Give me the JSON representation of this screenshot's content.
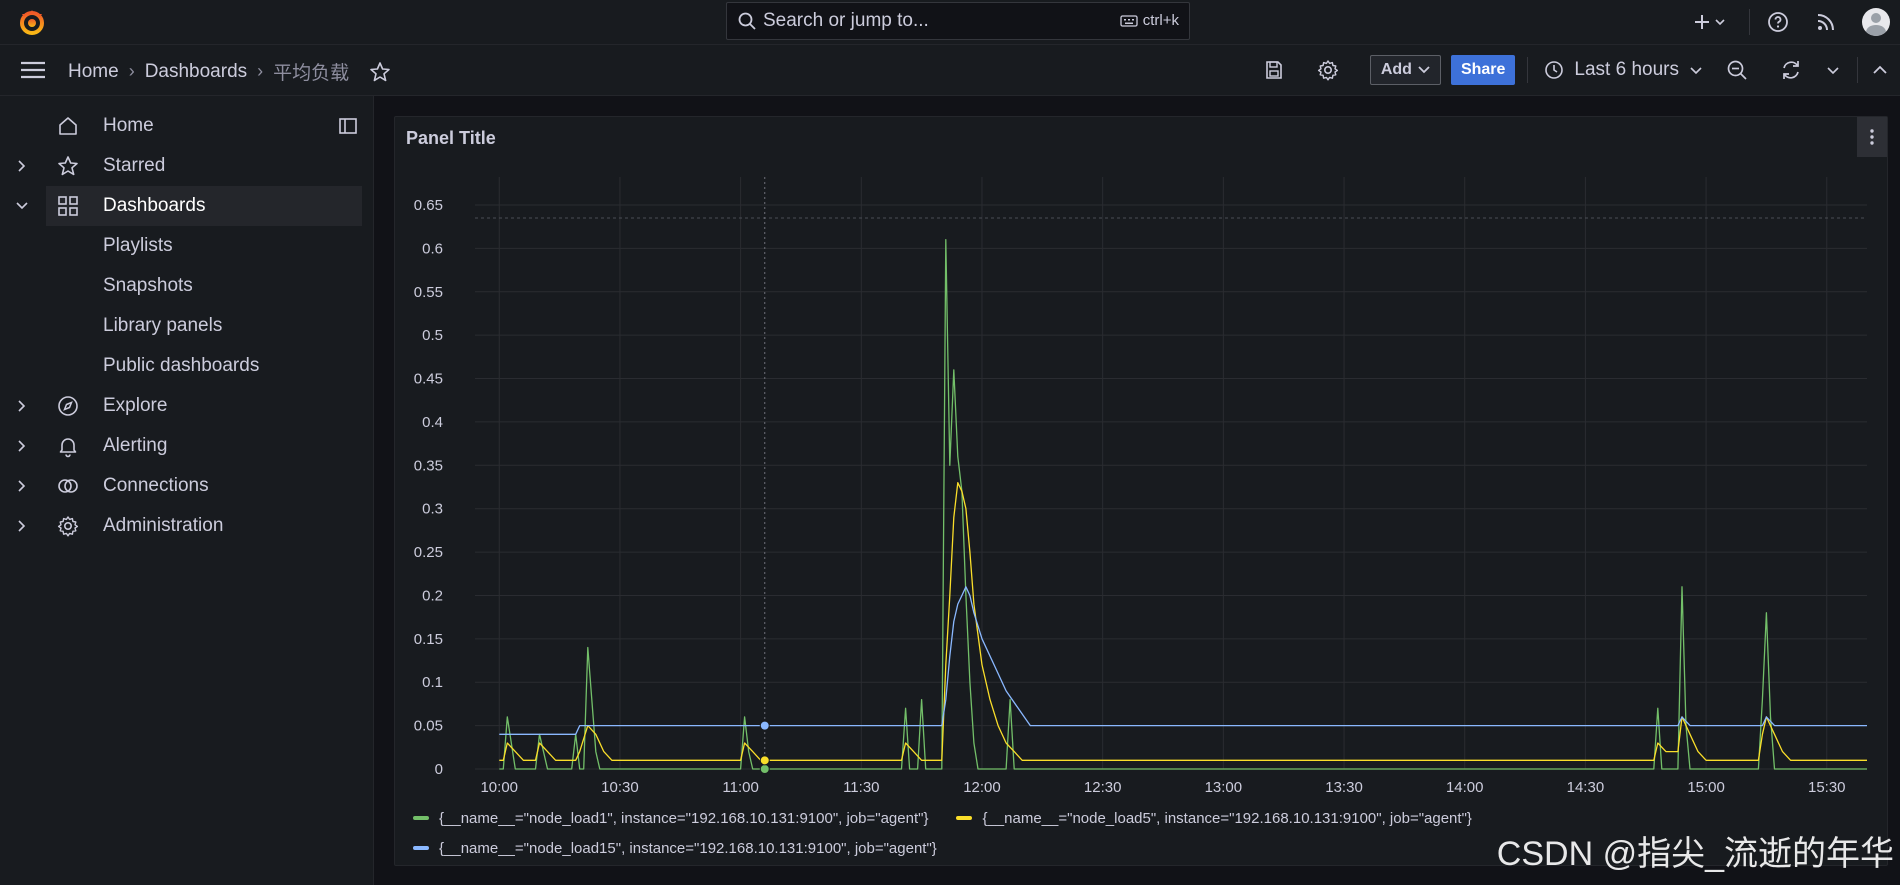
{
  "topbar": {
    "search_placeholder": "Search or jump to...",
    "search_shortcut": "ctrl+k",
    "icons": [
      "grafana-logo-icon",
      "plus-icon",
      "help-icon",
      "news-icon",
      "avatar"
    ]
  },
  "navbar": {
    "breadcrumbs": [
      "Home",
      "Dashboards",
      "平均负载"
    ],
    "add_label": "Add",
    "share_label": "Share",
    "time_range": "Last 6 hours"
  },
  "sidebar": {
    "items": [
      {
        "label": "Home",
        "icon": "home-icon"
      },
      {
        "label": "Starred",
        "icon": "star-icon"
      },
      {
        "label": "Dashboards",
        "icon": "apps-icon"
      },
      {
        "label": "Playlists"
      },
      {
        "label": "Snapshots"
      },
      {
        "label": "Library panels"
      },
      {
        "label": "Public dashboards"
      },
      {
        "label": "Explore",
        "icon": "compass-icon"
      },
      {
        "label": "Alerting",
        "icon": "bell-icon"
      },
      {
        "label": "Connections",
        "icon": "connections-icon"
      },
      {
        "label": "Administration",
        "icon": "cog-icon"
      }
    ]
  },
  "panel": {
    "title": "Panel Title"
  },
  "colors": {
    "load1": "#73bf69",
    "load5": "#fade2a",
    "load15": "#8ab8ff",
    "accent": "#f55f3e",
    "share": "#3d71d9"
  },
  "chart_data": {
    "type": "line",
    "title": "Panel Title",
    "x_ticks": [
      "10:00",
      "10:30",
      "11:00",
      "11:30",
      "12:00",
      "12:30",
      "13:00",
      "13:30",
      "14:00",
      "14:30",
      "15:00",
      "15:30"
    ],
    "y_ticks": [
      "0",
      "0.05",
      "0.1",
      "0.15",
      "0.2",
      "0.25",
      "0.3",
      "0.35",
      "0.4",
      "0.45",
      "0.5",
      "0.55",
      "0.6",
      "0.65"
    ],
    "ylim": [
      0,
      0.65
    ],
    "xlim": [
      "09:49",
      "15:40"
    ],
    "grid": true,
    "legend_position": "bottom",
    "series": [
      {
        "name": "{__name__=\"node_load1\", instance=\"192.168.10.131:9100\", job=\"agent\"}",
        "points": [
          [
            "10:00",
            0
          ],
          [
            "10:01",
            0
          ],
          [
            "10:02",
            0.06
          ],
          [
            "10:04",
            0
          ],
          [
            "10:09",
            0
          ],
          [
            "10:10",
            0.04
          ],
          [
            "10:12",
            0
          ],
          [
            "10:18",
            0
          ],
          [
            "10:19",
            0.04
          ],
          [
            "10:20",
            0
          ],
          [
            "10:21",
            0
          ],
          [
            "10:22",
            0.14
          ],
          [
            "10:24",
            0.02
          ],
          [
            "10:25",
            0
          ],
          [
            "11:00",
            0
          ],
          [
            "11:01",
            0.06
          ],
          [
            "11:02",
            0.02
          ],
          [
            "11:03",
            0
          ],
          [
            "11:40",
            0
          ],
          [
            "11:41",
            0.07
          ],
          [
            "11:42",
            0
          ],
          [
            "11:44",
            0
          ],
          [
            "11:45",
            0.08
          ],
          [
            "11:46",
            0
          ],
          [
            "11:50",
            0
          ],
          [
            "11:51",
            0.61
          ],
          [
            "11:52",
            0.35
          ],
          [
            "11:53",
            0.46
          ],
          [
            "11:54",
            0.36
          ],
          [
            "11:55",
            0.32
          ],
          [
            "11:56",
            0.2
          ],
          [
            "11:57",
            0.1
          ],
          [
            "11:58",
            0.03
          ],
          [
            "11:59",
            0
          ],
          [
            "12:06",
            0
          ],
          [
            "12:07",
            0.08
          ],
          [
            "12:08",
            0
          ],
          [
            "14:47",
            0
          ],
          [
            "14:48",
            0.07
          ],
          [
            "14:49",
            0
          ],
          [
            "14:53",
            0
          ],
          [
            "14:54",
            0.21
          ],
          [
            "14:55",
            0.05
          ],
          [
            "14:56",
            0
          ],
          [
            "15:13",
            0
          ],
          [
            "15:14",
            0.08
          ],
          [
            "15:15",
            0.18
          ],
          [
            "15:16",
            0.06
          ],
          [
            "15:17",
            0
          ],
          [
            "15:40",
            0
          ]
        ]
      },
      {
        "name": "{__name__=\"node_load5\", instance=\"192.168.10.131:9100\", job=\"agent\"}",
        "points": [
          [
            "10:00",
            0.01
          ],
          [
            "10:01",
            0.01
          ],
          [
            "10:02",
            0.03
          ],
          [
            "10:04",
            0.02
          ],
          [
            "10:06",
            0.01
          ],
          [
            "10:09",
            0.01
          ],
          [
            "10:10",
            0.03
          ],
          [
            "10:12",
            0.02
          ],
          [
            "10:14",
            0.01
          ],
          [
            "10:19",
            0.01
          ],
          [
            "10:20",
            0.02
          ],
          [
            "10:22",
            0.05
          ],
          [
            "10:24",
            0.04
          ],
          [
            "10:26",
            0.02
          ],
          [
            "10:28",
            0.01
          ],
          [
            "11:00",
            0.01
          ],
          [
            "11:01",
            0.03
          ],
          [
            "11:03",
            0.02
          ],
          [
            "11:05",
            0.01
          ],
          [
            "11:40",
            0.01
          ],
          [
            "11:41",
            0.03
          ],
          [
            "11:43",
            0.02
          ],
          [
            "11:45",
            0.01
          ],
          [
            "11:50",
            0.01
          ],
          [
            "11:51",
            0.12
          ],
          [
            "11:52",
            0.2
          ],
          [
            "11:53",
            0.29
          ],
          [
            "11:54",
            0.33
          ],
          [
            "11:55",
            0.32
          ],
          [
            "11:56",
            0.3
          ],
          [
            "11:57",
            0.25
          ],
          [
            "11:58",
            0.19
          ],
          [
            "12:00",
            0.12
          ],
          [
            "12:02",
            0.08
          ],
          [
            "12:04",
            0.05
          ],
          [
            "12:06",
            0.03
          ],
          [
            "12:08",
            0.02
          ],
          [
            "12:10",
            0.01
          ],
          [
            "14:47",
            0.01
          ],
          [
            "14:48",
            0.03
          ],
          [
            "14:50",
            0.02
          ],
          [
            "14:53",
            0.02
          ],
          [
            "14:54",
            0.06
          ],
          [
            "14:56",
            0.04
          ],
          [
            "14:58",
            0.02
          ],
          [
            "15:00",
            0.01
          ],
          [
            "15:13",
            0.01
          ],
          [
            "15:14",
            0.04
          ],
          [
            "15:15",
            0.06
          ],
          [
            "15:17",
            0.04
          ],
          [
            "15:19",
            0.02
          ],
          [
            "15:21",
            0.01
          ],
          [
            "15:40",
            0.01
          ]
        ]
      },
      {
        "name": "{__name__=\"node_load15\", instance=\"192.168.10.131:9100\", job=\"agent\"}",
        "points": [
          [
            "10:00",
            0.04
          ],
          [
            "10:19",
            0.04
          ],
          [
            "10:20",
            0.05
          ],
          [
            "11:50",
            0.05
          ],
          [
            "11:51",
            0.08
          ],
          [
            "11:52",
            0.13
          ],
          [
            "11:53",
            0.17
          ],
          [
            "11:54",
            0.19
          ],
          [
            "11:55",
            0.2
          ],
          [
            "11:56",
            0.21
          ],
          [
            "11:57",
            0.2
          ],
          [
            "11:58",
            0.18
          ],
          [
            "12:00",
            0.15
          ],
          [
            "12:03",
            0.12
          ],
          [
            "12:06",
            0.09
          ],
          [
            "12:09",
            0.07
          ],
          [
            "12:12",
            0.05
          ],
          [
            "14:53",
            0.05
          ],
          [
            "14:54",
            0.06
          ],
          [
            "14:56",
            0.05
          ],
          [
            "15:14",
            0.05
          ],
          [
            "15:15",
            0.06
          ],
          [
            "15:17",
            0.05
          ],
          [
            "15:40",
            0.05
          ]
        ]
      }
    ],
    "threshold_line": 0.635,
    "hover_time": "11:06"
  },
  "watermark": "CSDN @指尖_流逝的年华"
}
